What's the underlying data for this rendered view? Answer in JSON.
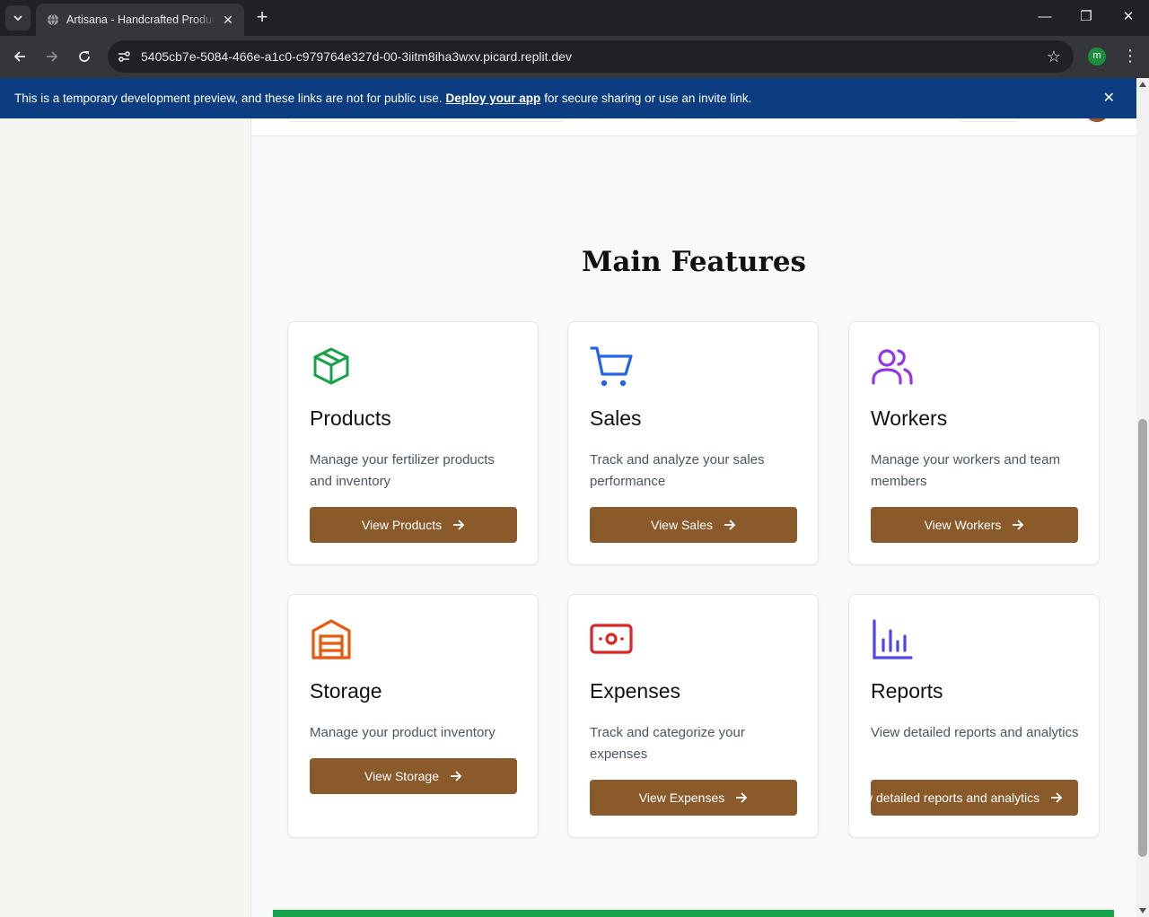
{
  "browser": {
    "tab_title": "Artisana - Handcrafted Products",
    "new_tab_label": "+",
    "url": "5405cb7e-5084-466e-a1c0-c979764e327d-00-3iitm8iha3wxv.picard.replit.dev",
    "profile_initial": "m"
  },
  "banner": {
    "text_before": "This is a temporary development preview, and these links are not for public use.",
    "link_text": "Deploy your app",
    "text_after": "for secure sharing or use an invite link."
  },
  "main": {
    "section_title": "Main Features",
    "cards": [
      {
        "title": "Products",
        "description": "Manage your fertilizer products and inventory",
        "button": "View Products",
        "icon": "package-icon",
        "color": "#16a34a"
      },
      {
        "title": "Sales",
        "description": "Track and analyze your sales performance",
        "button": "View Sales",
        "icon": "shopping-cart-icon",
        "color": "#2563eb"
      },
      {
        "title": "Workers",
        "description": "Manage your workers and team members",
        "button": "View Workers",
        "icon": "users-icon",
        "color": "#9333ea"
      },
      {
        "title": "Storage",
        "description": "Manage your product inventory",
        "button": "View Storage",
        "icon": "warehouse-icon",
        "color": "#ea580c"
      },
      {
        "title": "Expenses",
        "description": "Track and categorize your expenses",
        "button": "View Expenses",
        "icon": "banknote-icon",
        "color": "#dc2626"
      },
      {
        "title": "Reports",
        "description": "View detailed reports and analytics",
        "button": "View detailed reports and analytics",
        "icon": "bar-chart-icon",
        "color": "#4f46e5"
      }
    ]
  },
  "colors": {
    "button": "#8b5a2b",
    "banner": "#0c3d80",
    "footer_accent": "#16a34a"
  }
}
